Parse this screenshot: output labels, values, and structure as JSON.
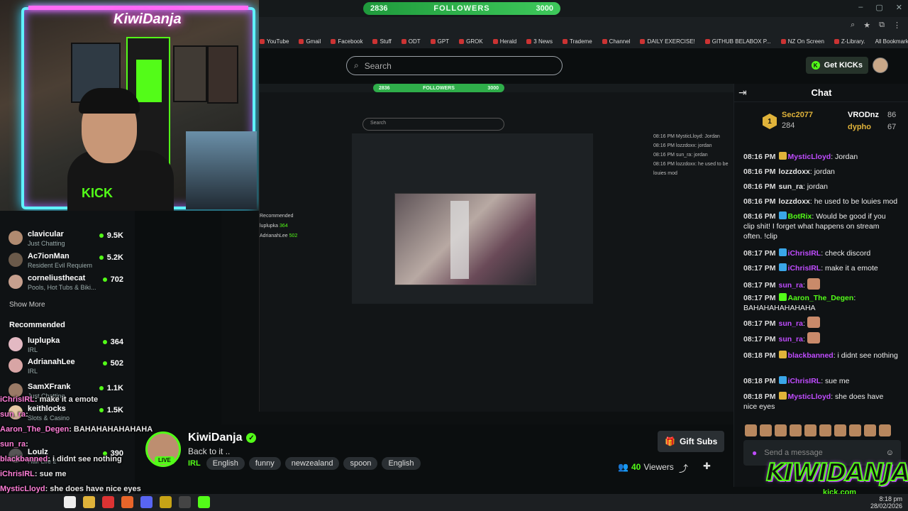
{
  "browser": {
    "followers_current": "2836",
    "followers_label": "FOLLOWERS",
    "followers_goal": "3000",
    "bookmarks": [
      "YouTube",
      "Gmail",
      "Facebook",
      "Stuff",
      "ODT",
      "GPT",
      "GROK",
      "Herald",
      "3 News",
      "Trademe",
      "Channel",
      "DAILY EXERCISE!",
      "GITHUB BELABOX P...",
      "NZ On Screen",
      "Z-Library."
    ],
    "all_bookmarks": "All Bookmarks"
  },
  "header": {
    "search_placeholder": "Search",
    "get_kicks": "Get KICKs"
  },
  "webcam": {
    "neon_sign": "KiwiDanja",
    "shirt_logo": "KICK"
  },
  "sidebar": {
    "items_top": [
      {
        "name": "clavicular",
        "category": "Just Chatting",
        "viewers": "9.5K",
        "color": "#b08a70"
      },
      {
        "name": "Ac7ionMan",
        "category": "Resident Evil Requiem",
        "viewers": "5.2K",
        "color": "#6b5a4a"
      },
      {
        "name": "corneliusthecat",
        "category": "Pools, Hot Tubs & Biki...",
        "viewers": "702",
        "color": "#c7a08e"
      }
    ],
    "show_more": "Show More",
    "recommended_title": "Recommended",
    "items_rec": [
      {
        "name": "luplupka",
        "category": "IRL",
        "viewers": "364",
        "color": "#e3b9c3"
      },
      {
        "name": "AdrianahLee",
        "category": "IRL",
        "viewers": "502",
        "color": "#d8a5a5"
      },
      {
        "name": "SamXFrank",
        "category": "Just Chatting",
        "viewers": "1.1K",
        "color": "#9a7a66"
      },
      {
        "name": "keithlocks",
        "category": "Slots & Casino",
        "viewers": "1.5K",
        "color": "#e5c8a4"
      },
      {
        "name": "Loulz",
        "category": "Half Life 2",
        "viewers": "390",
        "color": "#555"
      }
    ]
  },
  "overlay_chat": [
    {
      "user": "iChrisIRL",
      "text": ": make it a emote"
    },
    {
      "user": "sun_ra",
      "text": ":"
    },
    {
      "user": "Aaron_The_Degen",
      "text": ": BAHAHAHAHAHAHA"
    },
    {
      "user": "sun_ra",
      "text": ":"
    },
    {
      "user": "blackbanned",
      "text": ": i didnt see nothing"
    },
    {
      "user": "iChrisIRL",
      "text": ": sue me"
    },
    {
      "user": "MysticLloyd",
      "text": ": she does have nice eyes"
    }
  ],
  "stream": {
    "channel": "KiwiDanja",
    "title": "Back to it ..",
    "category": "IRL",
    "tags": [
      "English",
      "funny",
      "newzealand",
      "spoon",
      "English"
    ],
    "live": "LIVE",
    "gift_subs": "Gift Subs",
    "viewers": "40",
    "viewers_label": "Viewers"
  },
  "chat": {
    "title": "Chat",
    "leaderboard": {
      "first_name": "Sec2077",
      "first_points": "284",
      "rank": "1",
      "second_name": "VRODnz",
      "second_points": "86",
      "third_name": "dypho",
      "third_points": "67"
    },
    "messages": [
      {
        "time": "08:16 PM",
        "user": "MysticLloyd",
        "color": "#c04cff",
        "badge": "gold",
        "text": ": Jordan"
      },
      {
        "time": "08:16 PM",
        "user": "lozzdoxx",
        "color": "#e9e9e9",
        "badge": "",
        "text": ": jordan"
      },
      {
        "time": "08:16 PM",
        "user": "sun_ra",
        "color": "#e9e9e9",
        "badge": "",
        "text": ": jordan"
      },
      {
        "time": "08:16 PM",
        "user": "lozzdoxx",
        "color": "#e9e9e9",
        "badge": "",
        "text": ": he used to be louies mod"
      },
      {
        "time": "08:16 PM",
        "user": "BotRix",
        "color": "#53fc18",
        "badge": "blue",
        "text": ": Would be good if you clip shit! I forget what happens on stream often. !clip"
      },
      {
        "time": "08:17 PM",
        "user": "iChrisIRL",
        "color": "#c04cff",
        "badge": "blue",
        "text": ": check discord"
      },
      {
        "time": "08:17 PM",
        "user": "iChrisIRL",
        "color": "#c04cff",
        "badge": "blue",
        "text": ": make it a emote"
      },
      {
        "time": "08:17 PM",
        "user": "sun_ra",
        "color": "#c04cff",
        "badge": "",
        "text": ":"
      },
      {
        "time": "08:17 PM",
        "user": "Aaron_The_Degen",
        "color": "#53fc18",
        "badge": "green",
        "text": ": BAHAHAHAHAHAHA"
      },
      {
        "time": "08:17 PM",
        "user": "sun_ra",
        "color": "#c04cff",
        "badge": "",
        "text": ":"
      },
      {
        "time": "08:17 PM",
        "user": "sun_ra",
        "color": "#c04cff",
        "badge": "",
        "text": ":"
      },
      {
        "time": "08:18 PM",
        "user": "blackbanned",
        "color": "#c04cff",
        "badge": "gold",
        "text": ": i didnt see nothing"
      },
      {
        "time": "08:18 PM",
        "user": "iChrisIRL",
        "color": "#c04cff",
        "badge": "blue",
        "text": ": sue me"
      },
      {
        "time": "08:18 PM",
        "user": "MysticLloyd",
        "color": "#c04cff",
        "badge": "gold",
        "text": ": she does have nice eyes"
      }
    ],
    "input_placeholder": "Send a message"
  },
  "watermark": {
    "logo": "KIWIDANJA",
    "sub": "kick.com"
  },
  "taskbar": {
    "time": "8:18 pm",
    "date": "28/02/2026"
  }
}
